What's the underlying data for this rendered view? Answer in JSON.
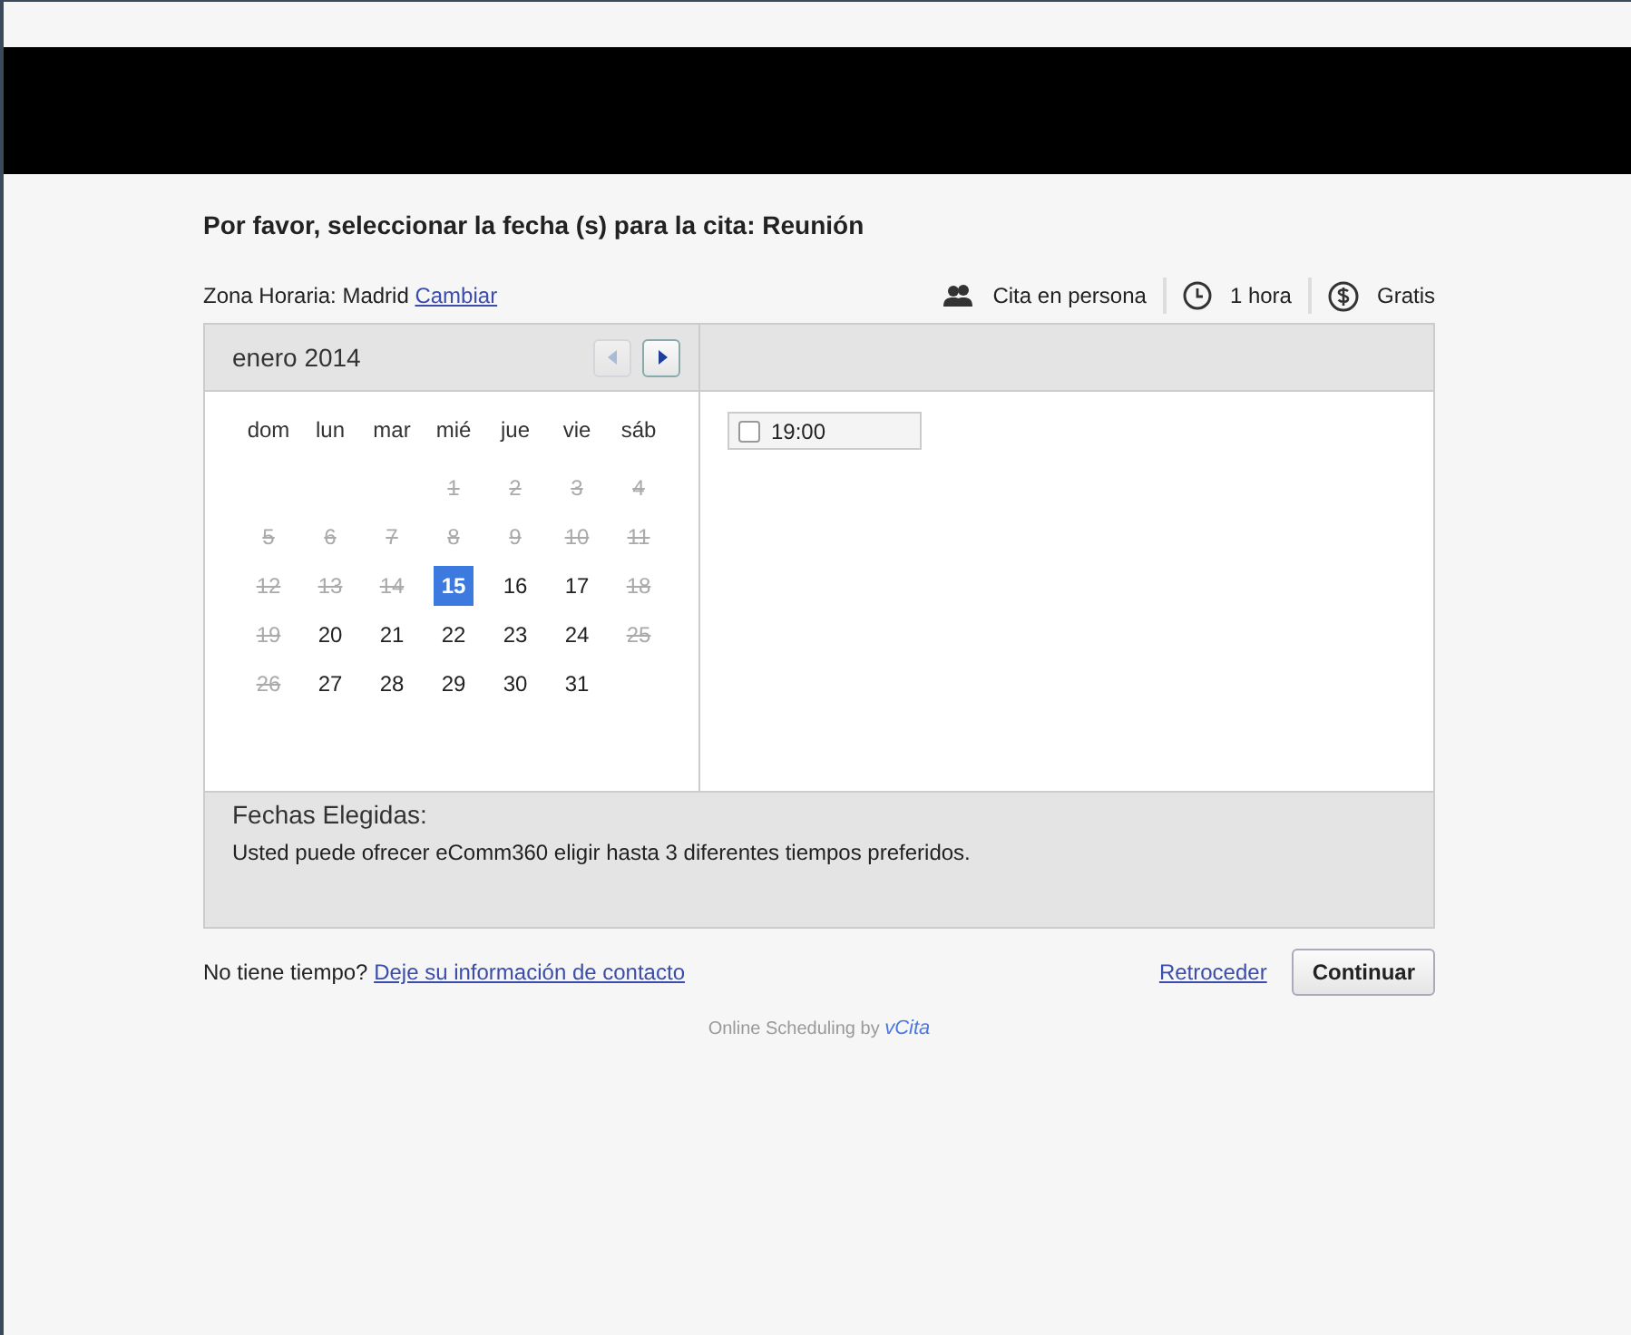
{
  "title": "Por favor, seleccionar la fecha (s) para la cita: Reunión",
  "timezone": {
    "label": "Zona Horaria: Madrid",
    "link": "Cambiar"
  },
  "details": [
    {
      "kind": "people",
      "text": "Cita en persona"
    },
    {
      "kind": "clock",
      "text": "1 hora"
    },
    {
      "kind": "dollar",
      "text": "Gratis"
    }
  ],
  "calendar": {
    "month": "enero 2014",
    "prev_disabled": true,
    "next_disabled": false,
    "weekdays": [
      "dom",
      "lun",
      "mar",
      "mié",
      "jue",
      "vie",
      "sáb"
    ],
    "days": [
      {
        "kind": "blank"
      },
      {
        "kind": "blank"
      },
      {
        "kind": "blank"
      },
      {
        "kind": "day",
        "text": "1",
        "available": false,
        "selected": false
      },
      {
        "kind": "day",
        "text": "2",
        "available": false,
        "selected": false
      },
      {
        "kind": "day",
        "text": "3",
        "available": false,
        "selected": false
      },
      {
        "kind": "day",
        "text": "4",
        "available": false,
        "selected": false
      },
      {
        "kind": "day",
        "text": "5",
        "available": false,
        "selected": false
      },
      {
        "kind": "day",
        "text": "6",
        "available": false,
        "selected": false
      },
      {
        "kind": "day",
        "text": "7",
        "available": false,
        "selected": false
      },
      {
        "kind": "day",
        "text": "8",
        "available": false,
        "selected": false
      },
      {
        "kind": "day",
        "text": "9",
        "available": false,
        "selected": false
      },
      {
        "kind": "day",
        "text": "10",
        "available": false,
        "selected": false
      },
      {
        "kind": "day",
        "text": "11",
        "available": false,
        "selected": false
      },
      {
        "kind": "day",
        "text": "12",
        "available": false,
        "selected": false
      },
      {
        "kind": "day",
        "text": "13",
        "available": false,
        "selected": false
      },
      {
        "kind": "day",
        "text": "14",
        "available": false,
        "selected": false
      },
      {
        "kind": "day",
        "text": "15",
        "available": true,
        "selected": true
      },
      {
        "kind": "day",
        "text": "16",
        "available": true,
        "selected": false
      },
      {
        "kind": "day",
        "text": "17",
        "available": true,
        "selected": false
      },
      {
        "kind": "day",
        "text": "18",
        "available": false,
        "selected": false
      },
      {
        "kind": "day",
        "text": "19",
        "available": false,
        "selected": false
      },
      {
        "kind": "day",
        "text": "20",
        "available": true,
        "selected": false
      },
      {
        "kind": "day",
        "text": "21",
        "available": true,
        "selected": false
      },
      {
        "kind": "day",
        "text": "22",
        "available": true,
        "selected": false
      },
      {
        "kind": "day",
        "text": "23",
        "available": true,
        "selected": false
      },
      {
        "kind": "day",
        "text": "24",
        "available": true,
        "selected": false
      },
      {
        "kind": "day",
        "text": "25",
        "available": false,
        "selected": false
      },
      {
        "kind": "day",
        "text": "26",
        "available": false,
        "selected": false
      },
      {
        "kind": "day",
        "text": "27",
        "available": true,
        "selected": false
      },
      {
        "kind": "day",
        "text": "28",
        "available": true,
        "selected": false
      },
      {
        "kind": "day",
        "text": "29",
        "available": true,
        "selected": false
      },
      {
        "kind": "day",
        "text": "30",
        "available": true,
        "selected": false
      },
      {
        "kind": "day",
        "text": "31",
        "available": true,
        "selected": false
      }
    ]
  },
  "times": [
    {
      "text": "19:00",
      "checked": false
    }
  ],
  "chosen": {
    "heading": "Fechas Elegidas:",
    "note": "Usted puede ofrecer eComm360 eligir hasta 3 diferentes tiempos preferidos."
  },
  "footer": {
    "question": "No tiene tiempo?",
    "contact_link": "Deje su información de contacto",
    "back": "Retroceder",
    "continue": "Continuar"
  },
  "credit": {
    "text": "Online Scheduling by",
    "brand": "vCita"
  }
}
